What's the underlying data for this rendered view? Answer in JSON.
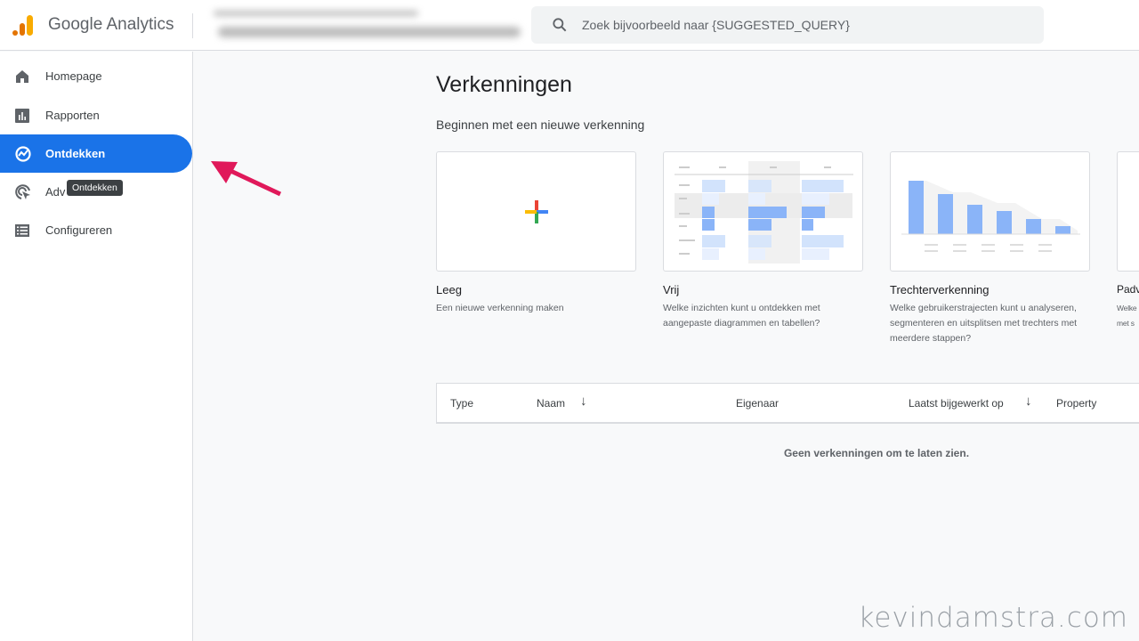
{
  "header": {
    "app_name": "Google Analytics",
    "search_placeholder": "Zoek bijvoorbeeld naar {SUGGESTED_QUERY}"
  },
  "sidebar": {
    "items": [
      {
        "label": "Homepage",
        "icon": "home-icon"
      },
      {
        "label": "Rapporten",
        "icon": "bar-chart-icon"
      },
      {
        "label": "Ontdekken",
        "icon": "explore-icon",
        "active": true
      },
      {
        "label": "Adv",
        "icon": "advertising-icon"
      },
      {
        "label": "Configureren",
        "icon": "list-icon"
      }
    ],
    "tooltip": "Ontdekken"
  },
  "main": {
    "title": "Verkenningen",
    "subtitle": "Beginnen met een nieuwe verkenning",
    "cards": [
      {
        "label": "Leeg",
        "desc": "Een nieuwe verkenning maken"
      },
      {
        "label": "Vrij",
        "desc": "Welke inzichten kunt u ontdekken met aangepaste diagrammen en tabellen?"
      },
      {
        "label": "Trechterverkenning",
        "desc": "Welke gebruikerstrajecten kunt u analyseren, segmenteren en uitsplitsen met trechters met meerdere stappen?"
      },
      {
        "label": "Padv",
        "desc": "Welke met s"
      }
    ],
    "table": {
      "columns": [
        "Type",
        "Naam",
        "Eigenaar",
        "Laatst bijgewerkt op",
        "Property"
      ],
      "empty": "Geen verkenningen om te laten zien."
    }
  },
  "colors": {
    "accent": "#1a73e8",
    "arrow": "#e0195a"
  },
  "watermark": "kevindamstra.com"
}
